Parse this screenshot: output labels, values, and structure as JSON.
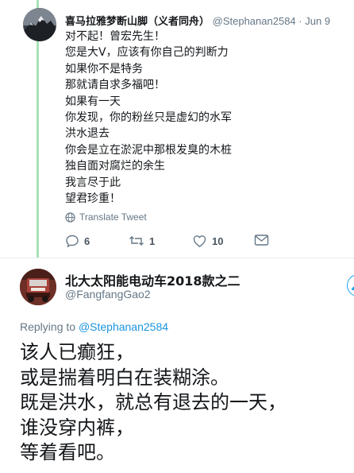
{
  "reply_tweet": {
    "author_name": "喜马拉雅梦断山脚（义者同舟）",
    "handle": "@Stephanan2584",
    "separator": "·",
    "date": "Jun 9",
    "lines": [
      "对不起！曾宏先生！",
      "您是大V，应该有你自己的判断力",
      "如果你不是特务",
      "那就请自求多福吧！",
      "如果有一天",
      "你发现，你的粉丝只是虚幻的水军",
      "洪水退去",
      "你会是立在淤泥中那根发臭的木桩",
      "独自面对腐烂的余生",
      "我言尽于此",
      "望君珍重！"
    ],
    "translate_label": "Translate Tweet",
    "reply_count": "6",
    "retweet_count": "1",
    "like_count": "10"
  },
  "main_tweet": {
    "author_name": "北大太阳能电动车2018款之二",
    "handle": "@FangfangGao2",
    "replying_prefix": "Replying to",
    "replying_handle": "@Stephanan2584",
    "lines": [
      "该人已癫狂，",
      "或是揣着明白在装糊涂。",
      "既是洪水，就总有退去的一天，",
      "谁没穿内裤，",
      "等着看吧。"
    ]
  },
  "colors": {
    "thread_line": "#a6e3b8",
    "link_blue": "#1b95e0",
    "muted_gray": "#657786"
  }
}
